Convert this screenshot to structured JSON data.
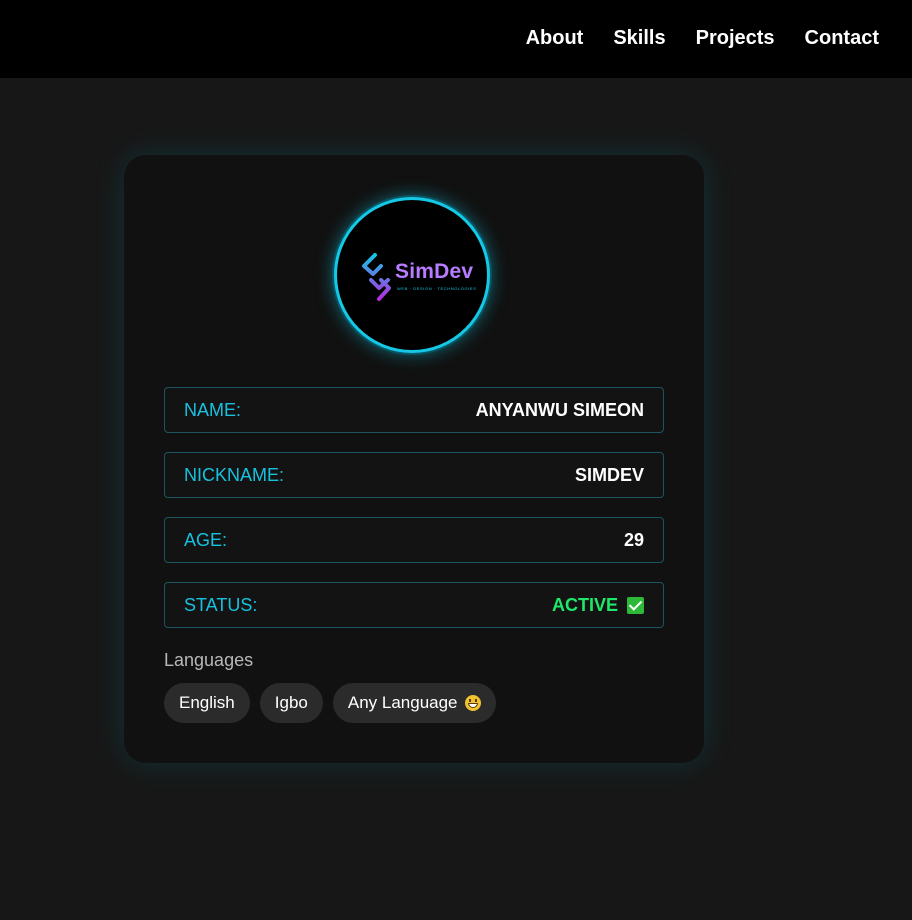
{
  "nav": {
    "links": [
      "About",
      "Skills",
      "Projects",
      "Contact"
    ]
  },
  "logo": {
    "text": "SimDev",
    "tagline": "WEB · DESIGN · TECHNOLOGIES"
  },
  "profile": {
    "rows": [
      {
        "label": "NAME:",
        "value": "ANYANWU SIMEON"
      },
      {
        "label": "NICKNAME:",
        "value": "SIMDEV"
      },
      {
        "label": "AGE:",
        "value": "29"
      },
      {
        "label": "STATUS:",
        "value": "ACTIVE"
      }
    ],
    "status_icon": "check-icon"
  },
  "languages": {
    "title": "Languages",
    "items": [
      "English",
      "Igbo",
      "Any Language"
    ],
    "emoji_icon": "grin-icon"
  },
  "colors": {
    "accent": "#16c2e0",
    "status_active": "#1ee86a",
    "background": "#171717",
    "card": "#111111"
  }
}
